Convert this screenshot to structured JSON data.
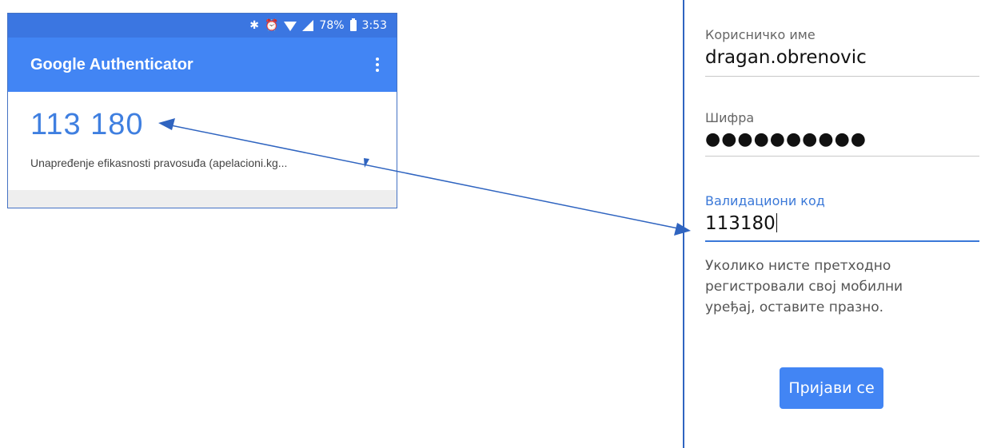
{
  "phone": {
    "status_bar": {
      "icons": [
        "bluetooth-icon",
        "alarm-icon",
        "wifi-icon",
        "signal-icon"
      ],
      "battery": "78%",
      "time": "3:53"
    },
    "app_title": "Google Authenticator",
    "menu_icon": "more-vert-icon",
    "entry": {
      "code": "113 180",
      "account": "Unapređenje efikasnosti pravosuđa (apelacioni.kg..."
    }
  },
  "login_form": {
    "username": {
      "label": "Корисничко име",
      "value": "dragan.obrenovic"
    },
    "password": {
      "label": "Шифра",
      "value": "●●●●●●●●●●"
    },
    "validation": {
      "label": "Валидациони код",
      "value": "113180"
    },
    "hint": "Уколико нисте претходно регистровали свој мобилни уређај, оставите празно.",
    "submit_label": "Пријави се"
  },
  "colors": {
    "status_bar": "#3b76e1",
    "app_bar": "#4285f4",
    "code": "#3f7fe0",
    "accent": "#3a78d8",
    "annotation": "#2f64c0"
  }
}
